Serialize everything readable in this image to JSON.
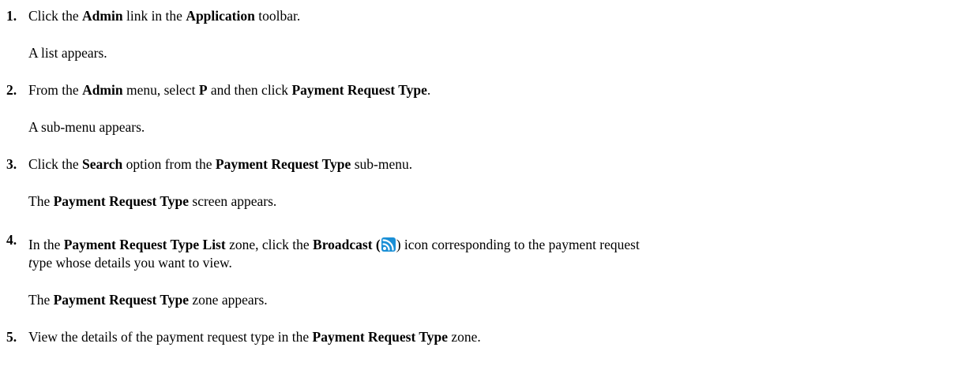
{
  "steps": [
    {
      "number": "1.",
      "parts": [
        "Click the ",
        "Admin",
        " link in the ",
        "Application",
        " toolbar."
      ],
      "result": "A list appears."
    },
    {
      "number": "2.",
      "parts": [
        "From the ",
        "Admin",
        " menu, select ",
        "P",
        " and then click ",
        "Payment Request Type",
        "."
      ],
      "result": "A sub-menu appears."
    },
    {
      "number": "3.",
      "parts": [
        "Click the ",
        "Search",
        " option from the ",
        "Payment Request Type",
        " sub-menu."
      ],
      "result_parts": [
        "The ",
        "Payment Request Type",
        " screen appears."
      ]
    },
    {
      "number": "4.",
      "parts": [
        "In the ",
        "Payment Request Type List",
        " zone, click the ",
        "Broadcast",
        " (",
        ") icon corresponding to the payment request"
      ],
      "continuation_parts": [
        "t",
        "ype whose details you want to view."
      ],
      "result_parts": [
        "The ",
        "Payment Request Type",
        " zone appears."
      ],
      "icon": "broadcast-icon",
      "icon_color": "#1a8fd6"
    },
    {
      "number": "5.",
      "parts": [
        "View the details of the payment request type in the ",
        "Payment Request Type",
        " zone."
      ]
    }
  ]
}
